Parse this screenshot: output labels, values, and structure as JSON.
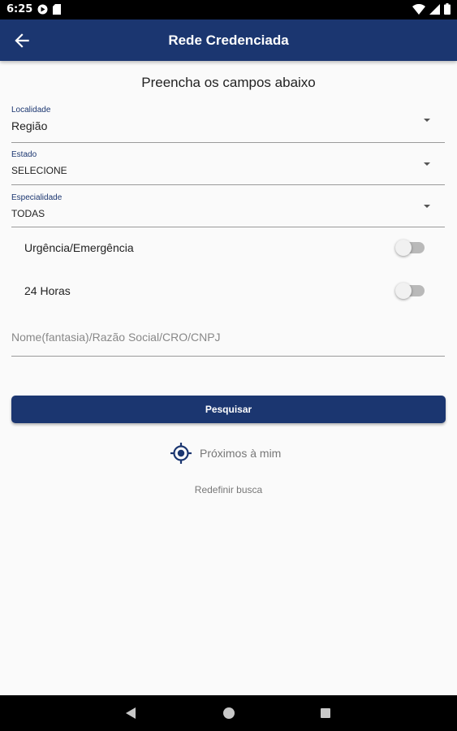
{
  "status_bar": {
    "time": "6:25",
    "left_icons": [
      "google-play-icon",
      "sd-card-icon"
    ],
    "right_icons": [
      "wifi-icon",
      "signal-icon",
      "battery-icon"
    ]
  },
  "app_bar": {
    "title": "Rede Credenciada",
    "back_icon": "arrow-back-icon",
    "color": "#1b3670"
  },
  "form": {
    "instruction": "Preencha os campos abaixo",
    "localidade": {
      "label": "Localidade",
      "value": "Região"
    },
    "estado": {
      "label": "Estado",
      "value": "SELECIONE"
    },
    "especialidade": {
      "label": "Especialidade",
      "value": "TODAS"
    },
    "urgencia": {
      "label": "Urgência/Emergência",
      "on": false
    },
    "horas24": {
      "label": "24 Horas",
      "on": false
    },
    "search": {
      "placeholder": "Nome(fantasia)/Razão Social/CRO/CNPJ",
      "value": ""
    },
    "submit_label": "Pesquisar",
    "nearby_label": "Próximos à mim",
    "nearby_icon": "location-target-icon",
    "reset_label": "Redefinir busca"
  },
  "nav_bar": {
    "icons": [
      "nav-back-icon",
      "nav-home-icon",
      "nav-recents-icon"
    ]
  }
}
